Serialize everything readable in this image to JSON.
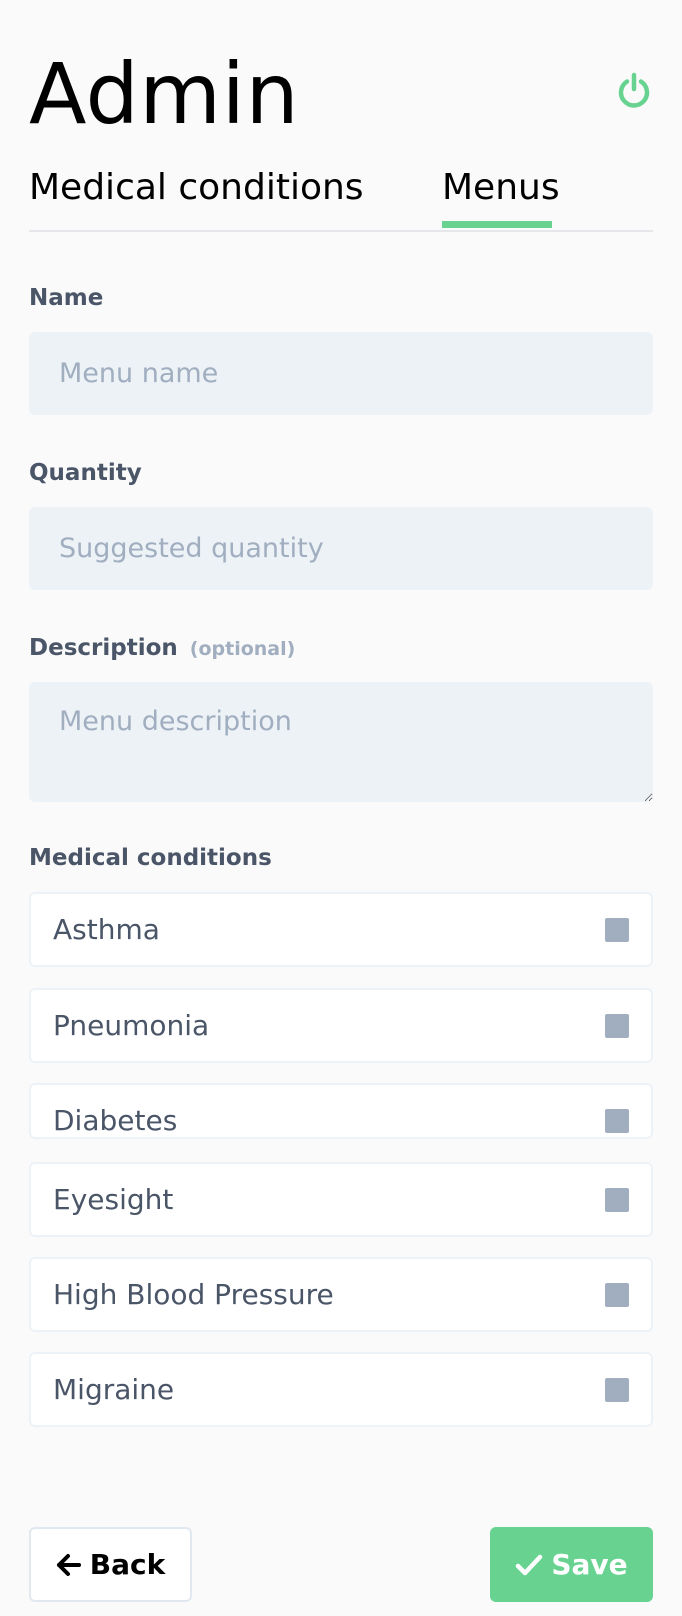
{
  "header": {
    "title": "Admin",
    "power_icon": "power-icon",
    "accent_color": "#68d391"
  },
  "tabs": [
    {
      "label": "Medical conditions",
      "active": false
    },
    {
      "label": "Menus",
      "active": true
    }
  ],
  "form": {
    "name": {
      "label": "Name",
      "placeholder": "Menu name",
      "value": ""
    },
    "quantity": {
      "label": "Quantity",
      "placeholder": "Suggested quantity",
      "value": ""
    },
    "description": {
      "label": "Description",
      "optional": "(optional)",
      "placeholder": "Menu description",
      "value": ""
    },
    "conditions_label": "Medical conditions",
    "conditions": [
      {
        "label": "Asthma",
        "checked": false
      },
      {
        "label": "Pneumonia",
        "checked": false
      },
      {
        "label": "Diabetes",
        "checked": false
      },
      {
        "label": "Eyesight",
        "checked": false
      },
      {
        "label": "High Blood Pressure",
        "checked": false
      },
      {
        "label": "Migraine",
        "checked": false
      }
    ]
  },
  "actions": {
    "back_label": "Back",
    "back_icon": "arrow-left-icon",
    "save_label": "Save",
    "save_icon": "check-icon"
  }
}
